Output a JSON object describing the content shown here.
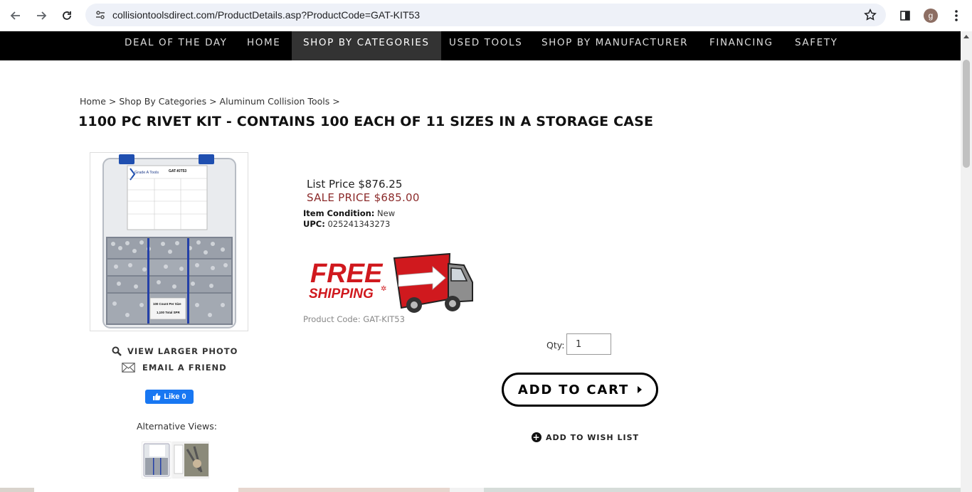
{
  "browser": {
    "url": "collisiontoolsdirect.com/ProductDetails.asp?ProductCode=GAT-KIT53",
    "profile_initial": "g"
  },
  "nav": {
    "items": [
      {
        "label": "DEAL OF THE DAY",
        "active": false
      },
      {
        "label": "HOME",
        "active": false
      },
      {
        "label": "SHOP BY CATEGORIES",
        "active": true
      },
      {
        "label": "USED TOOLS",
        "active": false
      },
      {
        "label": "SHOP BY MANUFACTURER",
        "active": false
      },
      {
        "label": "FINANCING",
        "active": false
      },
      {
        "label": "SAFETY",
        "active": false
      }
    ]
  },
  "breadcrumb": {
    "home": "Home",
    "sep": " > ",
    "category": "Shop By Categories",
    "subcategory": "Aluminum Collision Tools",
    "trailing": " >"
  },
  "product": {
    "title": "1100 PC RIVET KIT - CONTAINS 100 EACH OF 11 SIZES IN A STORAGE CASE",
    "list_price": "List Price $876.25",
    "sale_price": "SALE PRICE $685.00",
    "condition_label": "Item Condition:",
    "condition_value": "New",
    "upc_label": "UPC:",
    "upc_value": "025241343273",
    "product_code": "Product Code: GAT-KIT53",
    "image_labels": {
      "brand": "Grade A Tools",
      "code": "GAT-KIT53",
      "count": "100 Count Per Size",
      "total": "1,100 Total SPR"
    }
  },
  "image_links": {
    "view_larger": "VIEW LARGER PHOTO",
    "email_friend": "EMAIL A FRIEND"
  },
  "facebook": {
    "like_label": "Like 0"
  },
  "alternative_views_label": "Alternative Views:",
  "free_shipping": {
    "line1": "FREE",
    "line2": "SHIPPING"
  },
  "cart": {
    "qty_label": "Qty:",
    "qty_value": "1",
    "add_to_cart": "ADD TO CART",
    "add_to_wishlist": "ADD TO WISH LIST"
  },
  "colors": {
    "nav_bg": "#000000",
    "nav_active_bg": "#333333",
    "sale_price": "#8b2a2a",
    "fb_blue": "#1877f2",
    "free_ship_red": "#d0191e"
  }
}
